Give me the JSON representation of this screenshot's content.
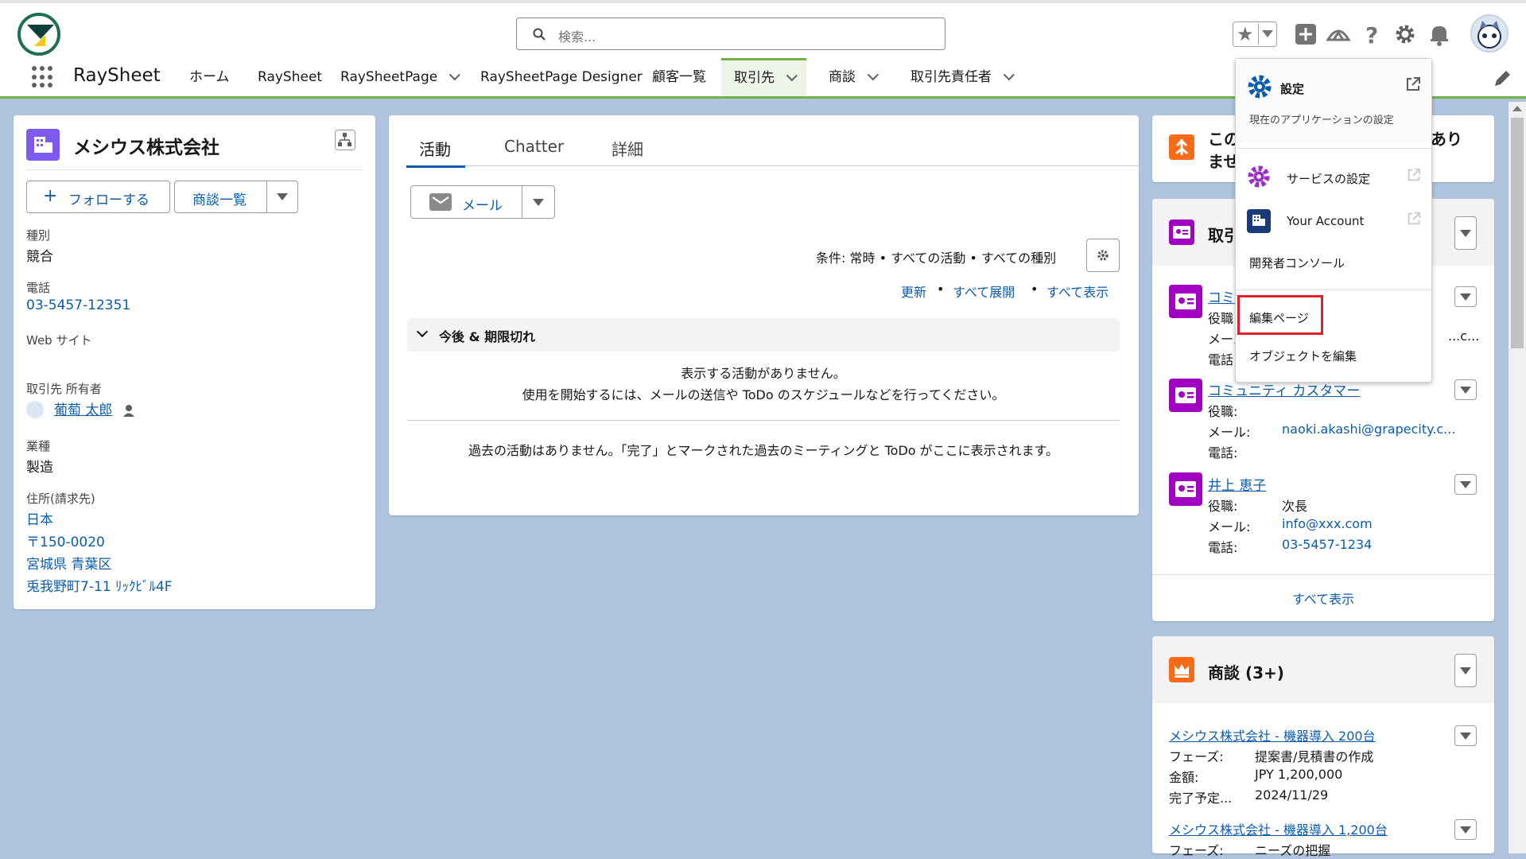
{
  "search": {
    "placeholder": "検索..."
  },
  "nav": {
    "app_name": "RaySheet",
    "items": [
      {
        "label": "ホーム"
      },
      {
        "label": "RaySheet"
      },
      {
        "label": "RaySheetPage"
      },
      {
        "label": "RaySheetPage Designer"
      },
      {
        "label": "顧客一覧"
      },
      {
        "label": "取引先"
      },
      {
        "label": "商談"
      },
      {
        "label": "取引先責任者"
      }
    ]
  },
  "account": {
    "name": "メシウス株式会社",
    "follow_label": "フォローする",
    "deals_list_label": "商談一覧",
    "fields": {
      "type_label": "種別",
      "type_value": "競合",
      "phone_label": "電話",
      "phone_value": "03-5457-12351",
      "website_label": "Web サイト",
      "owner_label": "取引先 所有者",
      "owner_value": "葡萄 太郎",
      "industry_label": "業種",
      "industry_value": "製造",
      "address_label": "住所(請求先)",
      "address_country": "日本",
      "address_zip": "〒150-0020",
      "address_city": "宮城県 青葉区",
      "address_street": "兎我野町7-11 ﾘｯｸﾋﾞﾙ4F"
    }
  },
  "activity": {
    "tabs": [
      "活動",
      "Chatter",
      "詳細"
    ],
    "email_button": "メール",
    "filter_text": "条件: 常時 • すべての活動 • すべての種別",
    "links": {
      "refresh": "更新",
      "expand_all": "すべて展開",
      "show_all": "すべて表示"
    },
    "dot": "•",
    "section_title": "今後 & 期限切れ",
    "empty_1": "表示する活動がありません。",
    "empty_2": "使用を開始するには、メールの送信や ToDo のスケジュールなどを行ってください。",
    "past_empty": "過去の活動はありません。「完了」とマークされた過去のミーティングと ToDo がここに表示されます。"
  },
  "right": {
    "notice_line1": "この",
    "notice_line1_end": "あり",
    "notice_line2": "ませ",
    "contacts_title": "取引",
    "contacts": [
      {
        "name": "コミ",
        "role_label": "役職",
        "role": "",
        "email_label": "メール",
        "email": "...c...",
        "phone_label": "電話",
        "phone": ""
      },
      {
        "name": "コミュニティ カスタマー",
        "role_label": "役職:",
        "role": "",
        "email_label": "メール:",
        "email": "naoki.akashi@grapecity.c...",
        "phone_label": "電話:",
        "phone": ""
      },
      {
        "name": "井上 恵子",
        "role_label": "役職:",
        "role": "次長",
        "email_label": "メール:",
        "email": "info@xxx.com",
        "phone_label": "電話:",
        "phone": "03-5457-1234"
      }
    ],
    "contacts_show_all": "すべて表示",
    "deals_title": "商談 (3+)",
    "deals": [
      {
        "name": "メシウス株式会社 - 機器導入 200台",
        "phase_label": "フェーズ:",
        "phase": "提案書/見積書の作成",
        "amount_label": "金額:",
        "amount": "JPY 1,200,000",
        "close_label": "完了予定...",
        "close": "2024/11/29"
      },
      {
        "name": "メシウス株式会社 - 機器導入 1,200台",
        "phase_label": "フェーズ:",
        "phase": "ニーズの把握"
      }
    ]
  },
  "settings_menu": {
    "settings_title": "設定",
    "settings_sub": "現在のアプリケーションの設定",
    "service_settings": "サービスの設定",
    "your_account": "Your Account",
    "dev_console": "開発者コンソール",
    "edit_page": "編集ページ",
    "edit_object": "オブジェクトを編集"
  },
  "colors": {
    "brand_link": "#0b5cab",
    "nav_active": "#6db346",
    "highlight_box": "#e0202a",
    "account_icon": "#7f5af0",
    "contact_icon": "#a100c2",
    "deal_icon": "#fa6a17",
    "settings_icon": "#0b5cab"
  }
}
